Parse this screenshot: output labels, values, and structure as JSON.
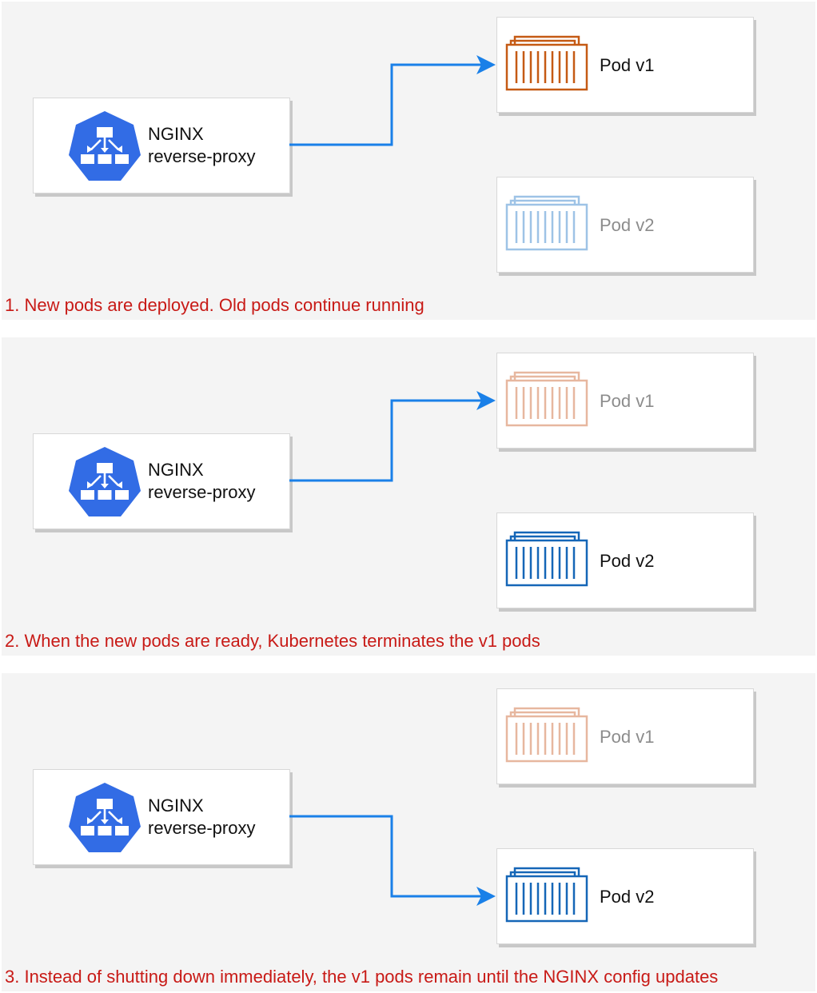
{
  "colors": {
    "panel_bg": "#f4f4f4",
    "arrow": "#1a80e8",
    "caption": "#c81a16",
    "k8s_blue": "#326ce5",
    "pod_v1_active": "#c55a14",
    "pod_v1_faded": "#e7b79f",
    "pod_v2_active": "#1566b7",
    "pod_v2_faded": "#9ec3e6"
  },
  "proxy": {
    "line1": "NGINX",
    "line2": "reverse-proxy",
    "icon": "kubernetes-service-icon"
  },
  "panels": [
    {
      "caption": "1. New pods are deployed. Old pods continue running",
      "routes_to": "Pod v1",
      "pod_v1": {
        "label": "Pod v1",
        "state": "active",
        "icon": "container-icon"
      },
      "pod_v2": {
        "label": "Pod v2",
        "state": "faded",
        "icon": "container-icon"
      }
    },
    {
      "caption": "2. When the new pods are ready, Kubernetes terminates the v1 pods",
      "routes_to": "Pod v1",
      "pod_v1": {
        "label": "Pod v1",
        "state": "faded",
        "icon": "container-icon"
      },
      "pod_v2": {
        "label": "Pod v2",
        "state": "active",
        "icon": "container-icon"
      }
    },
    {
      "caption": "3. Instead of shutting down immediately, the v1 pods remain until the NGINX config updates",
      "routes_to": "Pod v2",
      "pod_v1": {
        "label": "Pod v1",
        "state": "faded",
        "icon": "container-icon"
      },
      "pod_v2": {
        "label": "Pod v2",
        "state": "active",
        "icon": "container-icon"
      }
    }
  ]
}
